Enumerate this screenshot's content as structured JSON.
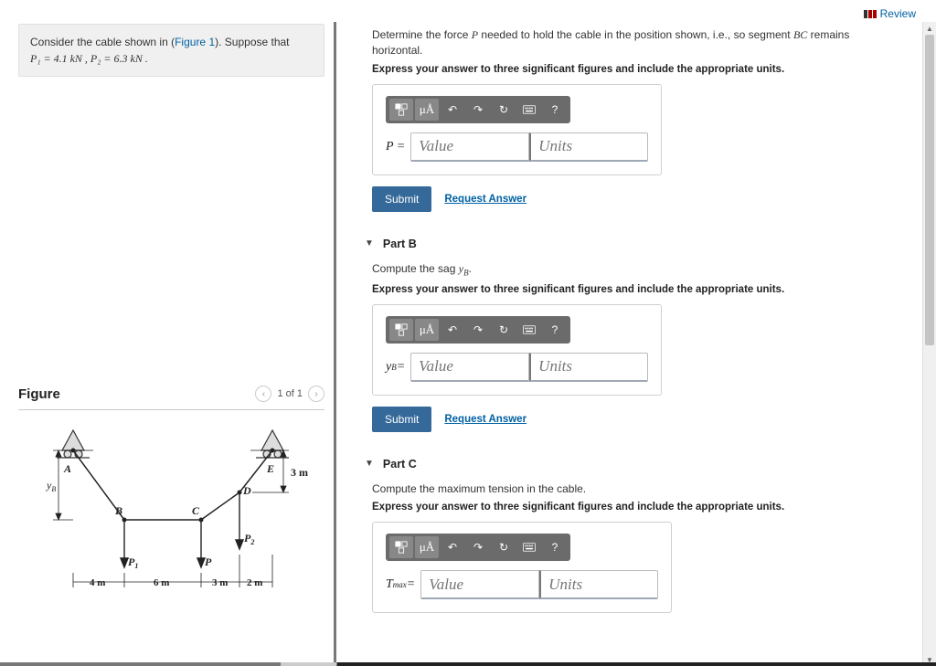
{
  "review": "Review",
  "problem": {
    "text_pre": "Consider the cable shown in (",
    "fig_link": "Figure 1",
    "text_post": "). Suppose that",
    "values": "P₁ = 4.1 kN , P₂ = 6.3 kN ."
  },
  "figure": {
    "title": "Figure",
    "pager": "1 of 1"
  },
  "diagram": {
    "A": "A",
    "B": "B",
    "C": "C",
    "D": "D",
    "E": "E",
    "yB": "y",
    "yB_sub": "B",
    "P1": "P",
    "P1_sub": "1",
    "P": "P",
    "P2": "P",
    "P2_sub": "2",
    "d3m": "3 m",
    "d4m": "4 m",
    "d6m": "6 m",
    "d3m2": "3 m",
    "d2m": "2 m"
  },
  "partA": {
    "desc_a": "Determine the force ",
    "desc_P": "P",
    "desc_b": " needed to hold the cable in the position shown, i.e., so segment ",
    "desc_BC": "BC",
    "desc_c": " remains horizontal.",
    "instruct": "Express your answer to three significant figures and include the appropriate units.",
    "var": "P =",
    "val_ph": "Value",
    "unit_ph": "Units",
    "submit": "Submit",
    "request": "Request Answer"
  },
  "partB": {
    "title": "Part B",
    "desc_a": "Compute the sag ",
    "desc_y": "y",
    "desc_sub": "B",
    "desc_c": ".",
    "instruct": "Express your answer to three significant figures and include the appropriate units.",
    "var_a": "y",
    "var_sub": "B",
    "var_c": " =",
    "val_ph": "Value",
    "unit_ph": "Units",
    "submit": "Submit",
    "request": "Request Answer"
  },
  "partC": {
    "title": "Part C",
    "desc": "Compute the maximum tension in the cable.",
    "instruct": "Express your answer to three significant figures and include the appropriate units.",
    "var_a": "T",
    "var_sub": "max",
    "var_c": " =",
    "val_ph": "Value",
    "unit_ph": "Units"
  },
  "toolbar": {
    "uA": "μÅ",
    "q": "?"
  }
}
